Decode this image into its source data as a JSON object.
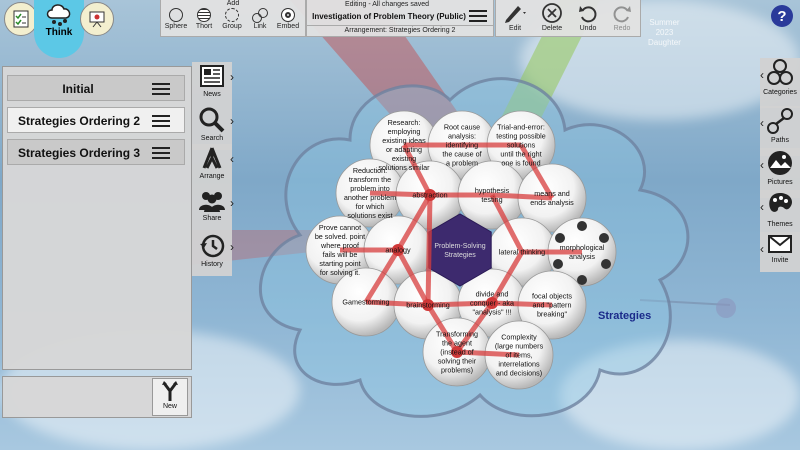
{
  "modes": [
    {
      "name": "Plan",
      "icon": "checklist-icon"
    },
    {
      "name": "Think",
      "icon": "cloud-network-icon"
    },
    {
      "name": "Present",
      "icon": "presentation-icon"
    }
  ],
  "toolbar": {
    "add_label": "Add",
    "add_items": [
      "Sphere",
      "Thort",
      "Group",
      "Link",
      "Embed"
    ],
    "status": "Editing - All changes saved",
    "title": "Investigation of Problem Theory (Public)",
    "arrangement": "Arrangement: Strategies Ordering 2",
    "edit_items": [
      "Edit",
      "Delete",
      "Undo",
      "Redo"
    ]
  },
  "arrangements": [
    "Initial",
    "Strategies Ordering 2",
    "Strategies Ordering 3"
  ],
  "new_label": "New",
  "left_tools": [
    "News",
    "Search",
    "Arrange",
    "Share",
    "History"
  ],
  "right_tools": [
    "Categories",
    "Paths",
    "Pictures",
    "Themes",
    "Invite"
  ],
  "group_label": "Strategies",
  "background_text": [
    "Summer",
    "2023",
    "Daughter"
  ],
  "center_node": [
    "Problem-Solving",
    "Strategies"
  ],
  "thorts": [
    [
      "Research:",
      "employing",
      "existing ideas",
      "or adapting",
      "existing",
      "solutions similar"
    ],
    [
      "Root cause",
      "analysis:",
      "identifying",
      "the cause of",
      "a problem"
    ],
    [
      "Trial-and-error:",
      "testing possible",
      "solutions",
      "until the right",
      "one is found"
    ],
    [
      "Reduction:",
      "transform the",
      "problem into",
      "another problem",
      "for which",
      "solutions exist"
    ],
    [
      "abstraction"
    ],
    [
      "hypothesis",
      "testing"
    ],
    [
      "means and",
      "ends analysis"
    ],
    [
      "Prove cannot",
      "be solved. point",
      "where proof",
      "fails will be",
      "starting point",
      "for solving it."
    ],
    [
      "analogy"
    ],
    [
      "lateral thinking"
    ],
    [
      "morphological",
      "analysis"
    ],
    [
      "Gamestorming"
    ],
    [
      "brainstorming"
    ],
    [
      "divide and",
      "conquer - aka",
      "\"analysis\" !!!"
    ],
    [
      "focal objects",
      "and \"pattern",
      "breaking\""
    ],
    [
      "Transforming",
      "the agent",
      "(instead of",
      "solving their",
      "problems)"
    ],
    [
      "Complexity",
      "(large numbers",
      "of items,",
      "interrelations",
      "and decisions)"
    ]
  ]
}
